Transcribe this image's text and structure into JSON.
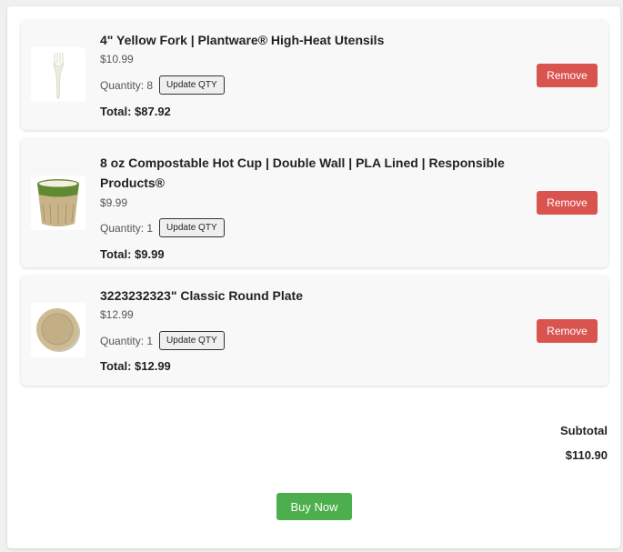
{
  "cart": {
    "items": [
      {
        "title": "4\" Yellow Fork | Plantware® High-Heat Utensils",
        "price": "$10.99",
        "quantity_label": "Quantity: 8",
        "update_label": "Update QTY",
        "total": "Total: $87.92",
        "remove_label": "Remove",
        "image_icon": "fork-image"
      },
      {
        "title": "8 oz Compostable Hot Cup | Double Wall | PLA Lined | Responsible Products®",
        "price": "$9.99",
        "quantity_label": "Quantity: 1",
        "update_label": "Update QTY",
        "total": "Total: $9.99",
        "remove_label": "Remove",
        "image_icon": "cup-image"
      },
      {
        "title": "3223232323\" Classic Round Plate",
        "price": "$12.99",
        "quantity_label": "Quantity: 1",
        "update_label": "Update QTY",
        "total": "Total: $12.99",
        "remove_label": "Remove",
        "image_icon": "plate-image"
      }
    ]
  },
  "summary": {
    "subtotal_label": "Subtotal",
    "subtotal_value": "$110.90"
  },
  "actions": {
    "buy_label": "Buy Now"
  },
  "colors": {
    "remove": "#d9534f",
    "buy": "#4cae4c",
    "card": "#f8f8f8"
  }
}
